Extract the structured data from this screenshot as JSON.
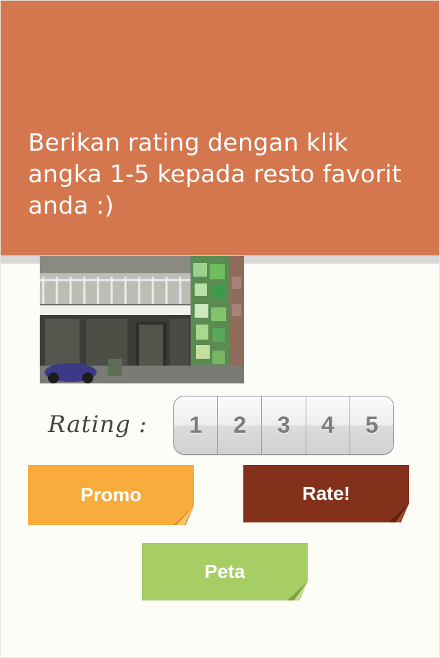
{
  "header": {
    "message": "Berikan rating dengan klik angka 1-5 kepada resto favorit anda :)"
  },
  "photo": {
    "subject": "restaurant-storefront"
  },
  "rating": {
    "label": "Rating :",
    "options": [
      "1",
      "2",
      "3",
      "4",
      "5"
    ]
  },
  "buttons": {
    "promo": "Promo",
    "rate": "Rate!",
    "peta": "Peta"
  },
  "colors": {
    "header": "#d4764e",
    "promo": "#f9ab3c",
    "rate": "#84311b",
    "peta": "#a7cd65",
    "background": "#fdfdf8"
  }
}
